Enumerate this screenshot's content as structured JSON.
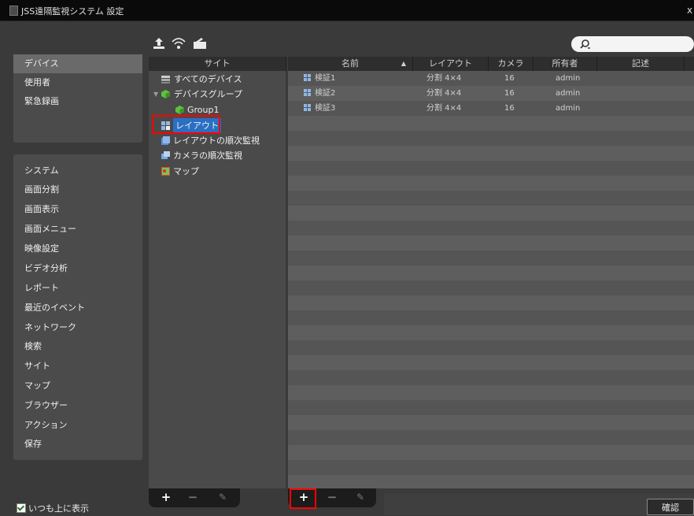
{
  "window": {
    "title": "JSS遠隔監視システム 設定",
    "close_glyph": "x"
  },
  "sidebar": {
    "group1": [
      {
        "label": "デバイス",
        "active": true
      },
      {
        "label": "使用者",
        "active": false
      },
      {
        "label": "緊急録画",
        "active": false
      }
    ],
    "group2": [
      {
        "label": "システム"
      },
      {
        "label": "画面分割"
      },
      {
        "label": "画面表示"
      },
      {
        "label": "画面メニュー"
      },
      {
        "label": "映像設定"
      },
      {
        "label": "ビデオ分析"
      },
      {
        "label": "レポート"
      },
      {
        "label": "最近のイベント"
      },
      {
        "label": "ネットワーク"
      },
      {
        "label": "検索"
      },
      {
        "label": "サイト"
      },
      {
        "label": "マップ"
      },
      {
        "label": "ブラウザー"
      },
      {
        "label": "アクション"
      },
      {
        "label": "保存"
      }
    ]
  },
  "toolbar_icons": [
    "upload-icon",
    "wireless-icon",
    "card-reader-icon"
  ],
  "search": {
    "placeholder": "",
    "icon": "search-icon"
  },
  "site_panel": {
    "header": "サイト",
    "tree": [
      {
        "label": "すべてのデバイス",
        "icon": "server-icon",
        "indent": 0,
        "expandable": false
      },
      {
        "label": "デバイスグループ",
        "icon": "green-cube-icon",
        "indent": 0,
        "expandable": true
      },
      {
        "label": "Group1",
        "icon": "green-cube-icon",
        "indent": 1,
        "expandable": false
      },
      {
        "label": "レイアウト",
        "icon": "layout-icon",
        "indent": 0,
        "expandable": false,
        "selected": true
      },
      {
        "label": "レイアウトの順次監視",
        "icon": "layout-sequence-icon",
        "indent": 0,
        "expandable": false
      },
      {
        "label": "カメラの順次監視",
        "icon": "camera-sequence-icon",
        "indent": 0,
        "expandable": false
      },
      {
        "label": "マップ",
        "icon": "map-icon",
        "indent": 0,
        "expandable": false
      }
    ],
    "bottom_buttons": {
      "add": "+",
      "remove": "−",
      "edit": "✎"
    }
  },
  "list_panel": {
    "columns": [
      "名前",
      "レイアウト",
      "カメラ",
      "所有者",
      "記述"
    ],
    "sort_glyph": "▲",
    "rows": [
      {
        "name": "検証1",
        "layout": "分割 4×4",
        "camera": "16",
        "owner": "admin",
        "desc": ""
      },
      {
        "name": "検証2",
        "layout": "分割 4×4",
        "camera": "16",
        "owner": "admin",
        "desc": ""
      },
      {
        "name": "検証3",
        "layout": "分割 4×4",
        "camera": "16",
        "owner": "admin",
        "desc": ""
      }
    ],
    "bottom_buttons": {
      "add": "+",
      "remove": "−",
      "edit": "✎"
    }
  },
  "footer": {
    "always_on_top": "いつも上に表示",
    "confirm": "確認"
  },
  "colors": {
    "highlight": "#ff0000",
    "selected": "#2a6fc4",
    "accent_green": "#5fbf3f"
  }
}
